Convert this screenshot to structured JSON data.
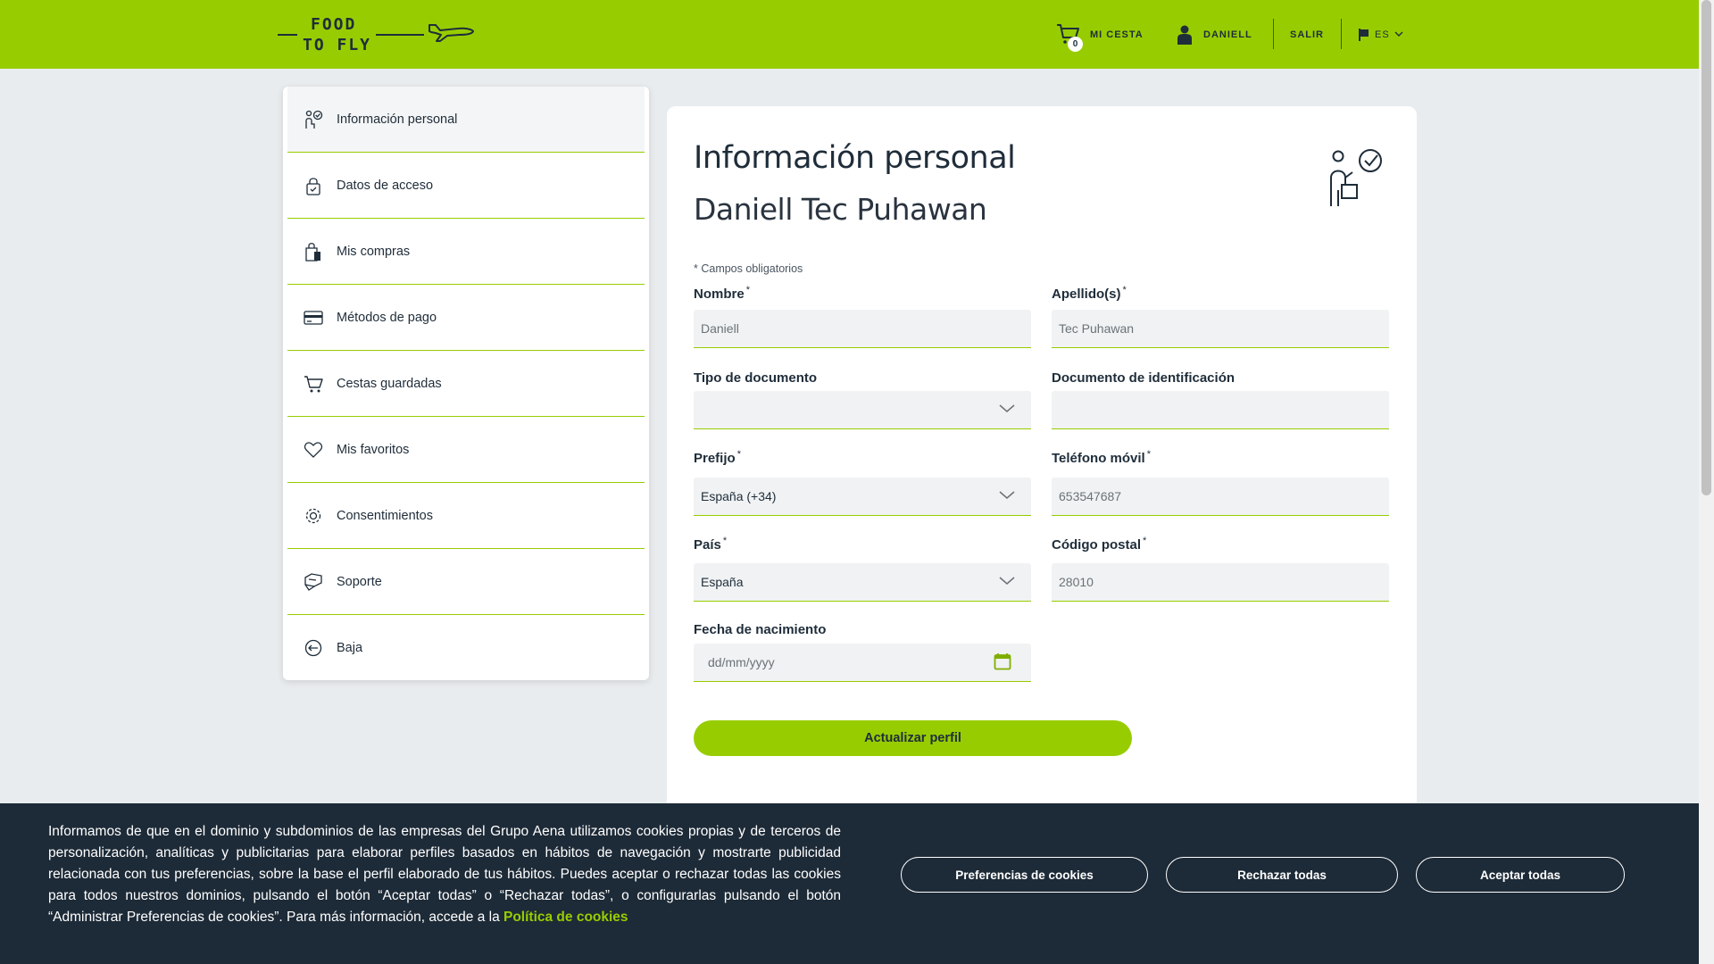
{
  "header": {
    "logo_line1": "FOOD",
    "logo_line2": "TO FLY",
    "cart_count": "0",
    "cart_label": "MI CESTA",
    "user_label": "DANIELL",
    "logout_label": "SALIR",
    "language": "ES",
    "brand_color": "#97cd00"
  },
  "sidebar": {
    "items": [
      {
        "label": "Información personal",
        "icon": "person-check-icon"
      },
      {
        "label": "Datos de acceso",
        "icon": "lock-icon"
      },
      {
        "label": "Mis compras",
        "icon": "shopping-bag-icon"
      },
      {
        "label": "Métodos de pago",
        "icon": "credit-card-icon"
      },
      {
        "label": "Cestas guardadas",
        "icon": "cart-icon"
      },
      {
        "label": "Mis favoritos",
        "icon": "heart-icon"
      },
      {
        "label": "Consentimientos",
        "icon": "gear-icon"
      },
      {
        "label": "Soporte",
        "icon": "support-icon"
      },
      {
        "label": "Baja",
        "icon": "exit-icon"
      }
    ]
  },
  "main": {
    "title": "Información personal",
    "name": "Daniell Tec Puhawan",
    "required_note": "* Campos obligatorios",
    "fields": {
      "nombre": {
        "label": "Nombre",
        "value": "Daniell"
      },
      "apellidos": {
        "label": "Apellido(s)",
        "value": "Tec Puhawan"
      },
      "tipo_documento": {
        "label": "Tipo de documento",
        "value": ""
      },
      "documento": {
        "label": "Documento de identificación",
        "value": ""
      },
      "prefijo": {
        "label": "Prefijo",
        "value": "España (+34)"
      },
      "telefono": {
        "label": "Teléfono móvil",
        "value": "653547687"
      },
      "pais": {
        "label": "País",
        "value": "España"
      },
      "codigo_postal": {
        "label": "Código postal",
        "value": "28010"
      },
      "fecha_nacimiento": {
        "label": "Fecha de nacimiento",
        "placeholder": "dd/mm/yyyy"
      }
    },
    "update_button": "Actualizar perfil"
  },
  "cookie_banner": {
    "text": "Informamos de que en el dominio y subdominios de las empresas del Grupo Aena utilizamos cookies propias y de terceros de personalización, analíticas y publicitarias para elaborar perfiles basados en hábitos de navegación y mostrarte publicidad relacionada con tus preferencias, sobre la base el perfil elaborado de tus hábitos. Puedes aceptar o rechazar todas las cookies para todos nuestros dominios, pulsando el botón “Aceptar todas” o “Rechazar todas”, o configurarlas pulsando el botón “Administrar Preferencias de cookies”. Para más información, accede a la",
    "link": "Política de cookies",
    "preferences_button": "Preferencias de cookies",
    "reject_button": "Rechazar todas",
    "accept_button": "Aceptar todas"
  }
}
